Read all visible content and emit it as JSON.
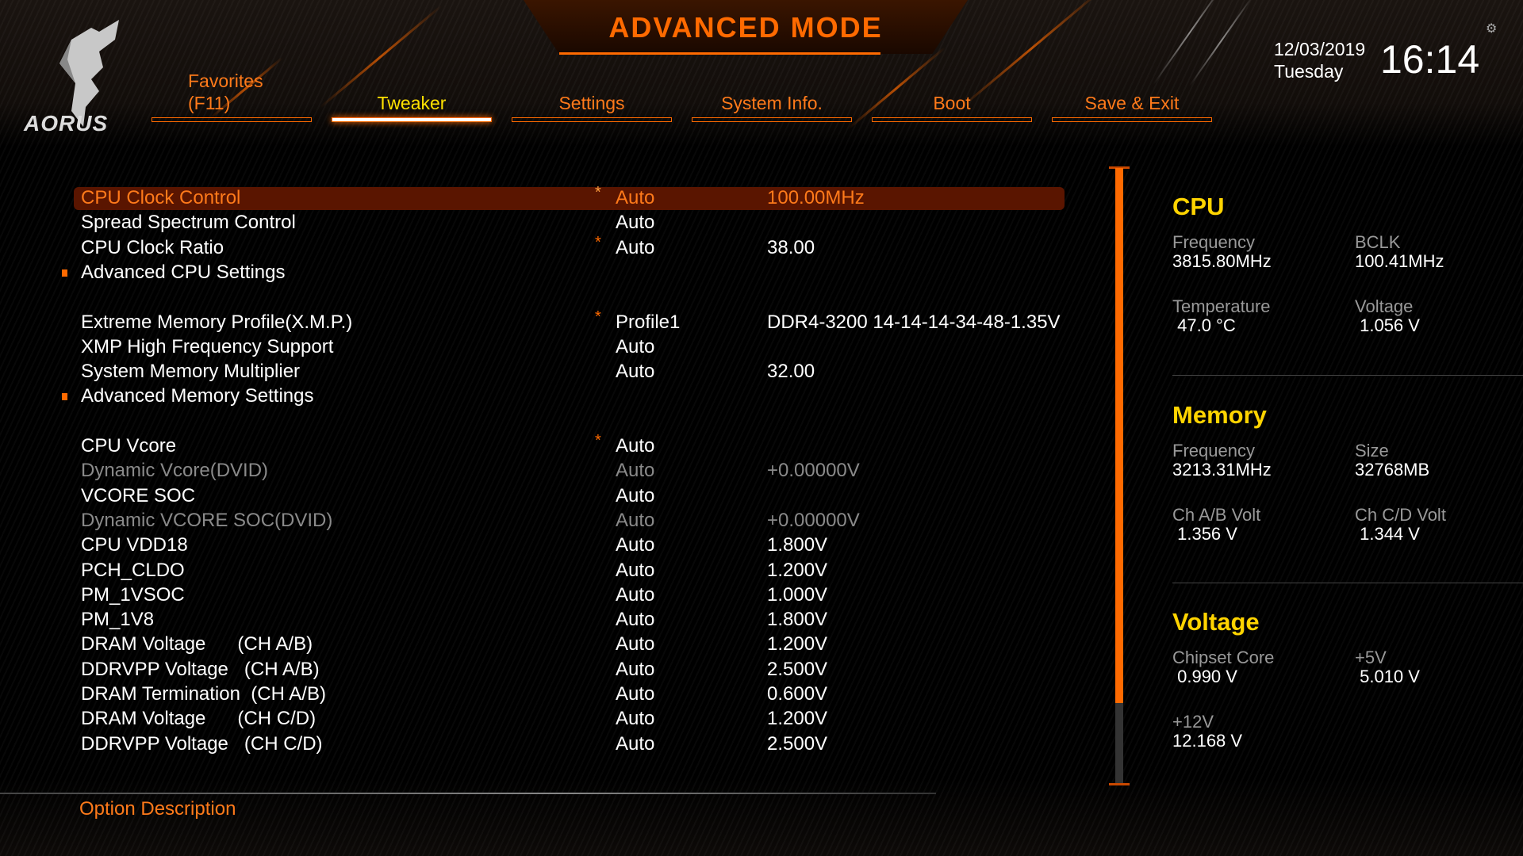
{
  "header": {
    "title": "ADVANCED MODE",
    "logo_text": "AORUS",
    "date": "12/03/2019",
    "day": "Tuesday",
    "time": "16:14"
  },
  "tabs": [
    {
      "label": "Favorites\n(F11)"
    },
    {
      "label": "Tweaker"
    },
    {
      "label": "Settings"
    },
    {
      "label": "System Info."
    },
    {
      "label": "Boot"
    },
    {
      "label": "Save & Exit"
    }
  ],
  "active_tab": "Tweaker",
  "settings": [
    {
      "label": "CPU Clock Control",
      "star": "*",
      "value": "Auto",
      "extra": "100.00MHz",
      "selected": true
    },
    {
      "label": "Spread Spectrum Control",
      "value": "Auto"
    },
    {
      "label": "CPU Clock Ratio",
      "star": "*",
      "value": "Auto",
      "extra": "38.00"
    },
    {
      "label": "Advanced CPU Settings",
      "submenu": true
    },
    null,
    {
      "label": "Extreme Memory Profile(X.M.P.)",
      "star": "*",
      "value": "Profile1",
      "extra": "DDR4-3200 14-14-14-34-48-1.35V"
    },
    {
      "label": "XMP High Frequency Support",
      "value": "Auto"
    },
    {
      "label": "System Memory Multiplier",
      "value": "Auto",
      "extra": "32.00"
    },
    {
      "label": "Advanced Memory Settings",
      "submenu": true
    },
    null,
    {
      "label": "CPU Vcore",
      "star": "*",
      "value": "Auto"
    },
    {
      "label": "Dynamic Vcore(DVID)",
      "value": "Auto",
      "extra": "+0.00000V",
      "disabled": true
    },
    {
      "label": "VCORE SOC",
      "value": "Auto"
    },
    {
      "label": "Dynamic VCORE SOC(DVID)",
      "value": "Auto",
      "extra": "+0.00000V",
      "disabled": true
    },
    {
      "label": "CPU VDD18",
      "value": "Auto",
      "extra": "1.800V"
    },
    {
      "label": "PCH_CLDO",
      "value": "Auto",
      "extra": "1.200V"
    },
    {
      "label": "PM_1VSOC",
      "value": "Auto",
      "extra": "1.000V"
    },
    {
      "label": "PM_1V8",
      "value": "Auto",
      "extra": "1.800V"
    },
    {
      "label": "DRAM Voltage      (CH A/B)",
      "value": "Auto",
      "extra": "1.200V"
    },
    {
      "label": "DDRVPP Voltage   (CH A/B)",
      "value": "Auto",
      "extra": "2.500V"
    },
    {
      "label": "DRAM Termination  (CH A/B)",
      "value": "Auto",
      "extra": "0.600V"
    },
    {
      "label": "DRAM Voltage      (CH C/D)",
      "value": "Auto",
      "extra": "1.200V"
    },
    {
      "label": "DDRVPP Voltage   (CH C/D)",
      "value": "Auto",
      "extra": "2.500V"
    }
  ],
  "option_description": "Option Description",
  "scroll_fraction": 0.87,
  "panel": {
    "cpu": {
      "title": "CPU",
      "frequency_label": "Frequency",
      "frequency": "3815.80MHz",
      "bclk_label": "BCLK",
      "bclk": "100.41MHz",
      "temp_label": "Temperature",
      "temp": " 47.0 °C",
      "voltage_label": "Voltage",
      "voltage": " 1.056 V"
    },
    "memory": {
      "title": "Memory",
      "frequency_label": "Frequency",
      "frequency": "3213.31MHz",
      "size_label": "Size",
      "size": "32768MB",
      "ab_label": "Ch A/B Volt",
      "ab": " 1.356 V",
      "cd_label": "Ch C/D Volt",
      "cd": " 1.344 V"
    },
    "voltage": {
      "title": "Voltage",
      "chipset_label": "Chipset Core",
      "chipset": " 0.990 V",
      "v5_label": "+5V",
      "v5": " 5.010 V",
      "v12_label": "+12V",
      "v12": "12.168 V"
    }
  },
  "colors": {
    "accent": "#ff6a00",
    "heading": "#ffd400",
    "selected_bg": "#5a1500"
  }
}
